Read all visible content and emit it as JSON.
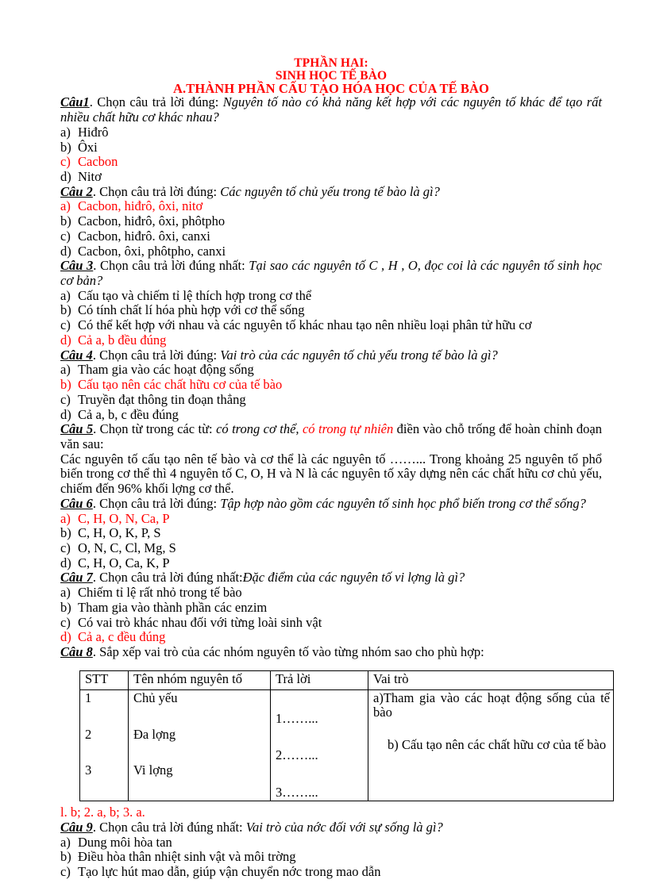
{
  "document": {
    "title_lines": [
      "TPHẦN HAI:",
      "SINH HỌC TẾ BÀO",
      "A.THÀNH PHẦN CẤU TẠO HÓA HỌC CỦA  TẾ BÀO"
    ],
    "colors": {
      "highlight": "#ff0000",
      "text": "#000000",
      "page_background": "#ffffff",
      "table_border": "#000000"
    }
  },
  "questions": [
    {
      "label": "Câu1",
      "instruction": ". Chọn câu trả lời đúng: ",
      "stem": "Nguyên tố nào có khả năng kết hợp với các nguyên tố khác để tạo rất nhiều chất hữu cơ khác nhau?",
      "options": [
        {
          "tag": "a)",
          "text": "Hiđrô",
          "highlight": false
        },
        {
          "tag": "b)",
          "text": "Ôxi",
          "highlight": false
        },
        {
          "tag": "c)",
          "text": "Cacbon",
          "highlight": true
        },
        {
          "tag": "d)",
          "text": "Nitơ",
          "highlight": false
        }
      ]
    },
    {
      "label": "Câu 2",
      "instruction": ". Chọn câu trả lời đúng: ",
      "stem": "Các nguyên tố chủ yếu trong tế bào là gì?",
      "options": [
        {
          "tag": "a)",
          "text": "Cacbon, hiđrô, ôxi, nitơ",
          "highlight": true
        },
        {
          "tag": "b)",
          "text": "Cacbon, hiđrô, ôxi, phôtpho",
          "highlight": false
        },
        {
          "tag": "c)",
          "text": "Cacbon, hiđrô. ôxi, canxi",
          "highlight": false
        },
        {
          "tag": "d)",
          "text": "Cacbon, ôxi, phôtpho, canxi",
          "highlight": false
        }
      ]
    },
    {
      "label": "Câu 3",
      "instruction": ". Chọn câu trả lời đúng nhất: ",
      "stem": "Tại sao các nguyên tố C , H , O, đọc   coi là các nguyên tố sinh học cơ bản?",
      "options": [
        {
          "tag": "a)",
          "text": "Cấu tạo và chiếm tỉ lệ thích hợp trong cơ thể",
          "highlight": false
        },
        {
          "tag": "b)",
          "text": "Có tính chất lí hóa phù hợp với cơ thể sống",
          "highlight": false
        },
        {
          "tag": "c)",
          "text": "Có thể kết hợp với nhau và các nguyên tố khác nhau tạo nên nhiều loại phân tử hữu cơ",
          "highlight": false,
          "wrap": true
        },
        {
          "tag": "d)",
          "text": "Cả a, b đều đúng",
          "highlight": true
        }
      ]
    },
    {
      "label": "Câu 4",
      "instruction": ". Chọn câu trả lời đúng: ",
      "stem": "Vai trò của các nguyên tố chủ yếu trong tế bào là gì?",
      "options": [
        {
          "tag": "a)",
          "text": "Tham gia vào các hoạt động sống",
          "highlight": false
        },
        {
          "tag": "b)",
          "text": "Cấu tạo nên các chất hữu cơ của tế bào",
          "highlight": true
        },
        {
          "tag": "c)",
          "text": "Truyền đạt thông tin đoạn thẳng",
          "highlight": false
        },
        {
          "tag": "d)",
          "text": "Cả a, b, c đều đúng",
          "highlight": false
        }
      ]
    }
  ],
  "cau5": {
    "label": "Câu 5",
    "instruction": ". Chọn từ trong các từ: ",
    "choice_black": "có trong cơ thể, ",
    "choice_red": "có trong tự nhiên",
    "instruction_tail": " điền vào chỗ trống để hoàn chỉnh đoạn văn sau:",
    "paragraph": "Các nguyên tố cấu tạo nên tế bào và cơ thể là các nguyên tố ……... Trong khoảng 25 nguyên tố phổ biến trong cơ thể thì 4 nguyên tố C, O, H và N là các nguyên tố xây dựng nên các chất hữu cơ chủ yếu, chiếm đến 96% khối lợng   cơ thể."
  },
  "questions2": [
    {
      "label": "Câu 6",
      "instruction": ". Chọn câu trả lời đúng: ",
      "stem": "Tập hợp nào gồm các nguyên tố sinh học phổ biến trong cơ thể sống?",
      "options": [
        {
          "tag": "a)",
          "text": "C, H, O, N, Ca, P",
          "highlight": true
        },
        {
          "tag": "b)",
          "text": "C, H, O, K, P, S",
          "highlight": false
        },
        {
          "tag": "c)",
          "text": "O, N, C, Cl, Mg, S",
          "highlight": false
        },
        {
          "tag": "d)",
          "text": "C, H, O, Ca, K, P",
          "highlight": false
        }
      ]
    },
    {
      "label": "Câu 7",
      "instruction": ". Chọn câu trả lời đúng nhất:",
      "stem": "Đặc điểm của các nguyên tố vi lợng   là gì?",
      "options": [
        {
          "tag": "a)",
          "text": "Chiếm tỉ lệ rất nhỏ trong tế bào",
          "highlight": false
        },
        {
          "tag": "b)",
          "text": "Tham gia vào thành phần các enzim",
          "highlight": false
        },
        {
          "tag": "c)",
          "text": "Có vai trò khác nhau đối với từng loài sinh vật",
          "highlight": false
        },
        {
          "tag": "d)",
          "text": "Cả a, c đều đúng",
          "highlight": true
        }
      ]
    }
  ],
  "cau8": {
    "label": "Câu 8",
    "instruction": ". Sắp xếp  vai trò của các nhóm nguyên tố vào từng nhóm sao cho phù hợp:",
    "table": {
      "headers": [
        "STT",
        "Tên nhóm nguyên tố",
        "Trả lời",
        "Vai trò"
      ],
      "stt": [
        "1",
        "2",
        "3"
      ],
      "groups": [
        "Chủ yếu",
        "Đa lợng",
        "Vi lợng"
      ],
      "answers": [
        "1……...",
        "2……...",
        "3……..."
      ],
      "roles": [
        "a)Tham gia vào các hoạt động sống của tế bào",
        "b) Cấu tạo nên các chất hữu cơ của tế bào"
      ]
    },
    "answer_key": "l. b; 2. a, b; 3. a."
  },
  "cau9": {
    "label": "Câu 9",
    "instruction": ". Chọn câu trả lời đúng nhất: ",
    "stem": "Vai trò của nớc   đối với sự sống là gì?",
    "options": [
      {
        "tag": "a)",
        "text": "Dung môi hòa tan",
        "highlight": false
      },
      {
        "tag": "b)",
        "text": "Điều hòa thân nhiệt sinh vật và môi trờng",
        "highlight": false
      },
      {
        "tag": "c)",
        "text": "Tạo lực hút mao dẫn, giúp vận chuyển nớc trong mao dẫn",
        "highlight": false
      }
    ]
  }
}
